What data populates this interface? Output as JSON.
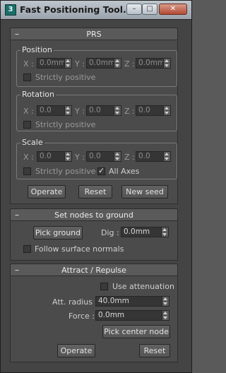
{
  "window": {
    "title": "Fast Positioning Tool...",
    "icon": "3",
    "minimize": "–",
    "maximize": "□",
    "close": "✕"
  },
  "prs": {
    "title": "PRS",
    "collapse": "–",
    "position": {
      "label": "Position",
      "x": "0.0mm",
      "y": "0.0mm",
      "z": "0.0mm",
      "strictly": "Strictly positive"
    },
    "rotation": {
      "label": "Rotation",
      "x": "0.0",
      "y": "0.0",
      "z": "0.0",
      "strictly": "Strictly positive"
    },
    "scale": {
      "label": "Scale",
      "x": "0.0",
      "y": "0.0",
      "z": "0.0",
      "strictly": "Strictly positive",
      "all_axes": "All Axes",
      "all_axes_checked": true
    },
    "axis_x": "X :",
    "axis_y": "Y :",
    "axis_z": "Z :",
    "operate": "Operate",
    "reset": "Reset",
    "new_seed": "New seed"
  },
  "ground": {
    "title": "Set nodes to ground",
    "collapse": "–",
    "pick_ground": "Pick ground",
    "dig_label": "Dig :",
    "dig_value": "0.0mm",
    "follow_normals": "Follow surface normals"
  },
  "attract": {
    "title": "Attract / Repulse",
    "collapse": "–",
    "use_attenuation": "Use attenuation",
    "att_radius_label": "Att. radius :",
    "att_radius_value": "40.0mm",
    "force_label": "Force :",
    "force_value": "0.0mm",
    "pick_center": "Pick center node",
    "operate": "Operate",
    "reset": "Reset"
  }
}
